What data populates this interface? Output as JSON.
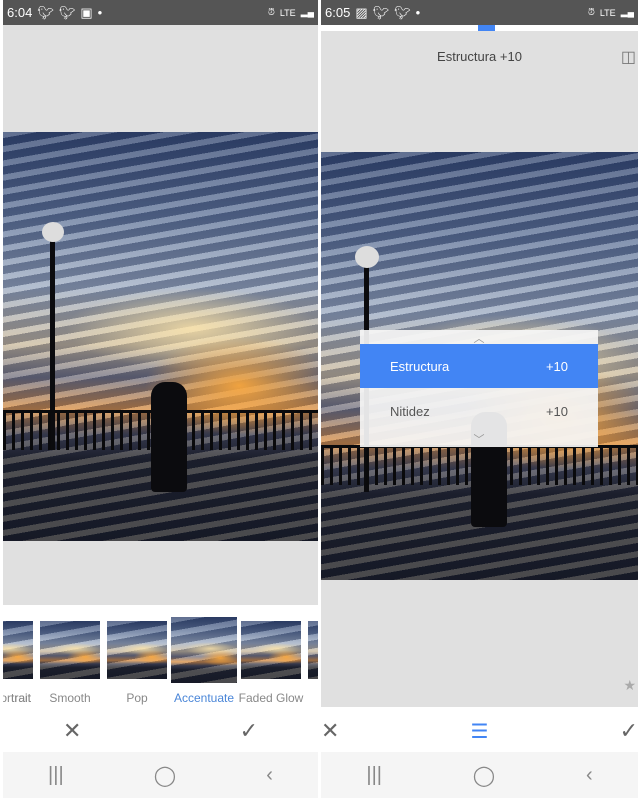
{
  "left": {
    "status": {
      "time": "6:04",
      "icons": [
        "twitter-icon",
        "twitter-icon",
        "flipboard-icon",
        "dot-icon"
      ],
      "right_icons": [
        "alarm-icon",
        "lte-icon",
        "signal-icon",
        "battery-icon"
      ],
      "lte": "LTE"
    },
    "filters": [
      {
        "label": "Portrait",
        "visible": "trait"
      },
      {
        "label": "Smooth"
      },
      {
        "label": "Pop"
      },
      {
        "label": "Accentuate",
        "selected": true
      },
      {
        "label": "Faded Glow"
      },
      {
        "label": ""
      }
    ],
    "actions": {
      "cancel": "✕",
      "apply": "✓"
    }
  },
  "right": {
    "status": {
      "time": "6:05",
      "icons": [
        "gallery-icon",
        "twitter-icon",
        "twitter-icon",
        "dot-icon"
      ],
      "lte": "LTE"
    },
    "adjust_label": "Estructura +10",
    "menu": [
      {
        "label": "Estructura",
        "value": "+10",
        "selected": true
      },
      {
        "label": "Nitidez",
        "value": "+10"
      }
    ],
    "actions": {
      "cancel": "✕",
      "apply": "✓"
    }
  },
  "nav": {
    "recents": "|||",
    "home": "◯",
    "back": "‹"
  },
  "colors": {
    "accent": "#4285f4",
    "status_bar": "#555555",
    "canvas": "#e0e0e0"
  }
}
